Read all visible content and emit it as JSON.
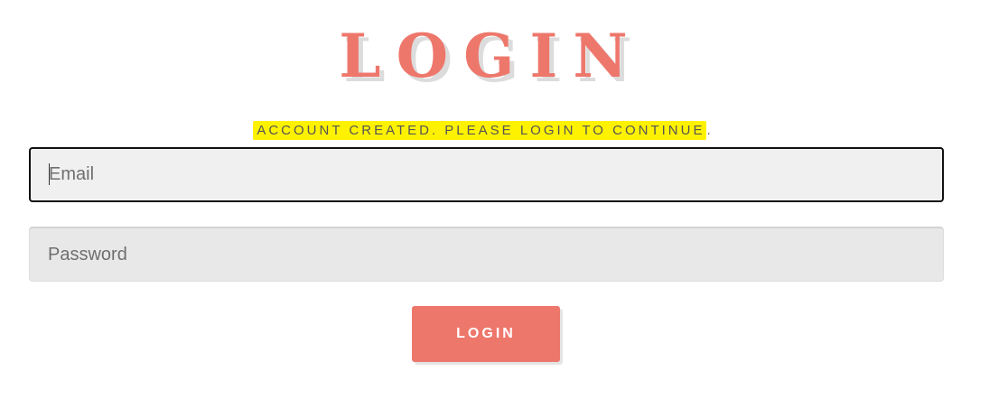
{
  "login_form": {
    "title": "LOGIN",
    "message": "ACCOUNT CREATED. PLEASE LOGIN TO CONTINUE",
    "message_suffix": ".",
    "email_placeholder": "Email",
    "email_value": "",
    "password_placeholder": "Password",
    "password_value": "",
    "submit_label": "LOGIN"
  },
  "colors": {
    "accent": "#ee776c",
    "highlight": "#fff200"
  }
}
